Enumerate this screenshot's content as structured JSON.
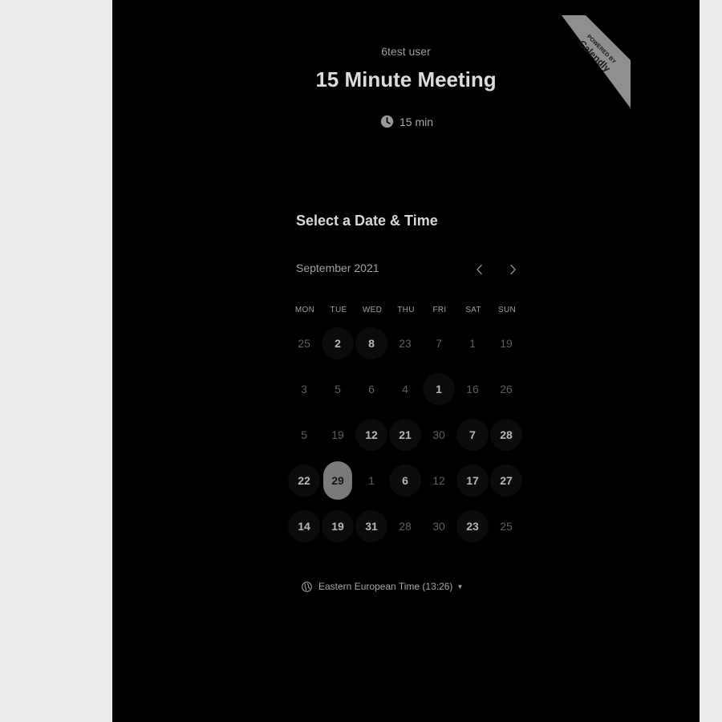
{
  "badge": {
    "line1": "POWERED BY",
    "line2": "Calendly"
  },
  "event": {
    "host": "6test user",
    "title": "15 Minute Meeting",
    "duration": "15 min",
    "duration_icon": "clock-icon"
  },
  "scheduler": {
    "heading": "Select a Date & Time",
    "month": "September 2021",
    "prev_icon": "chevron-left-icon",
    "next_icon": "chevron-right-icon",
    "weekdays": [
      "MON",
      "TUE",
      "WED",
      "THU",
      "FRI",
      "SAT",
      "SUN"
    ],
    "weeks": [
      [
        {
          "label": "25",
          "available": false
        },
        {
          "label": "2",
          "available": true
        },
        {
          "label": "8",
          "available": true
        },
        {
          "label": "23",
          "available": false
        },
        {
          "label": "7",
          "available": false
        },
        {
          "label": "1",
          "available": false
        },
        {
          "label": "19",
          "available": false
        }
      ],
      [
        {
          "label": "3",
          "available": false
        },
        {
          "label": "5",
          "available": false
        },
        {
          "label": "6",
          "available": false
        },
        {
          "label": "4",
          "available": false
        },
        {
          "label": "1",
          "available": true
        },
        {
          "label": "16",
          "available": false
        },
        {
          "label": "26",
          "available": false
        }
      ],
      [
        {
          "label": "5",
          "available": false
        },
        {
          "label": "19",
          "available": false
        },
        {
          "label": "12",
          "available": true
        },
        {
          "label": "21",
          "available": true
        },
        {
          "label": "30",
          "available": false
        },
        {
          "label": "7",
          "available": true
        },
        {
          "label": "28",
          "available": true
        }
      ],
      [
        {
          "label": "22",
          "available": true
        },
        {
          "label": "29",
          "available": true,
          "selected": true
        },
        {
          "label": "1",
          "available": false
        },
        {
          "label": "6",
          "available": true
        },
        {
          "label": "12",
          "available": false
        },
        {
          "label": "17",
          "available": true
        },
        {
          "label": "27",
          "available": true
        }
      ],
      [
        {
          "label": "14",
          "available": true
        },
        {
          "label": "19",
          "available": true
        },
        {
          "label": "31",
          "available": true
        },
        {
          "label": "28",
          "available": false
        },
        {
          "label": "30",
          "available": false
        },
        {
          "label": "23",
          "available": true
        },
        {
          "label": "25",
          "available": false
        }
      ]
    ],
    "timezone": "Eastern European Time (13:26)",
    "timezone_icon": "globe-icon"
  },
  "colors": {
    "page_bg": "#ebebeb",
    "panel_bg": "#000000",
    "selected_day": "#7a7a7a",
    "badge_bg": "#8f8f8f"
  }
}
